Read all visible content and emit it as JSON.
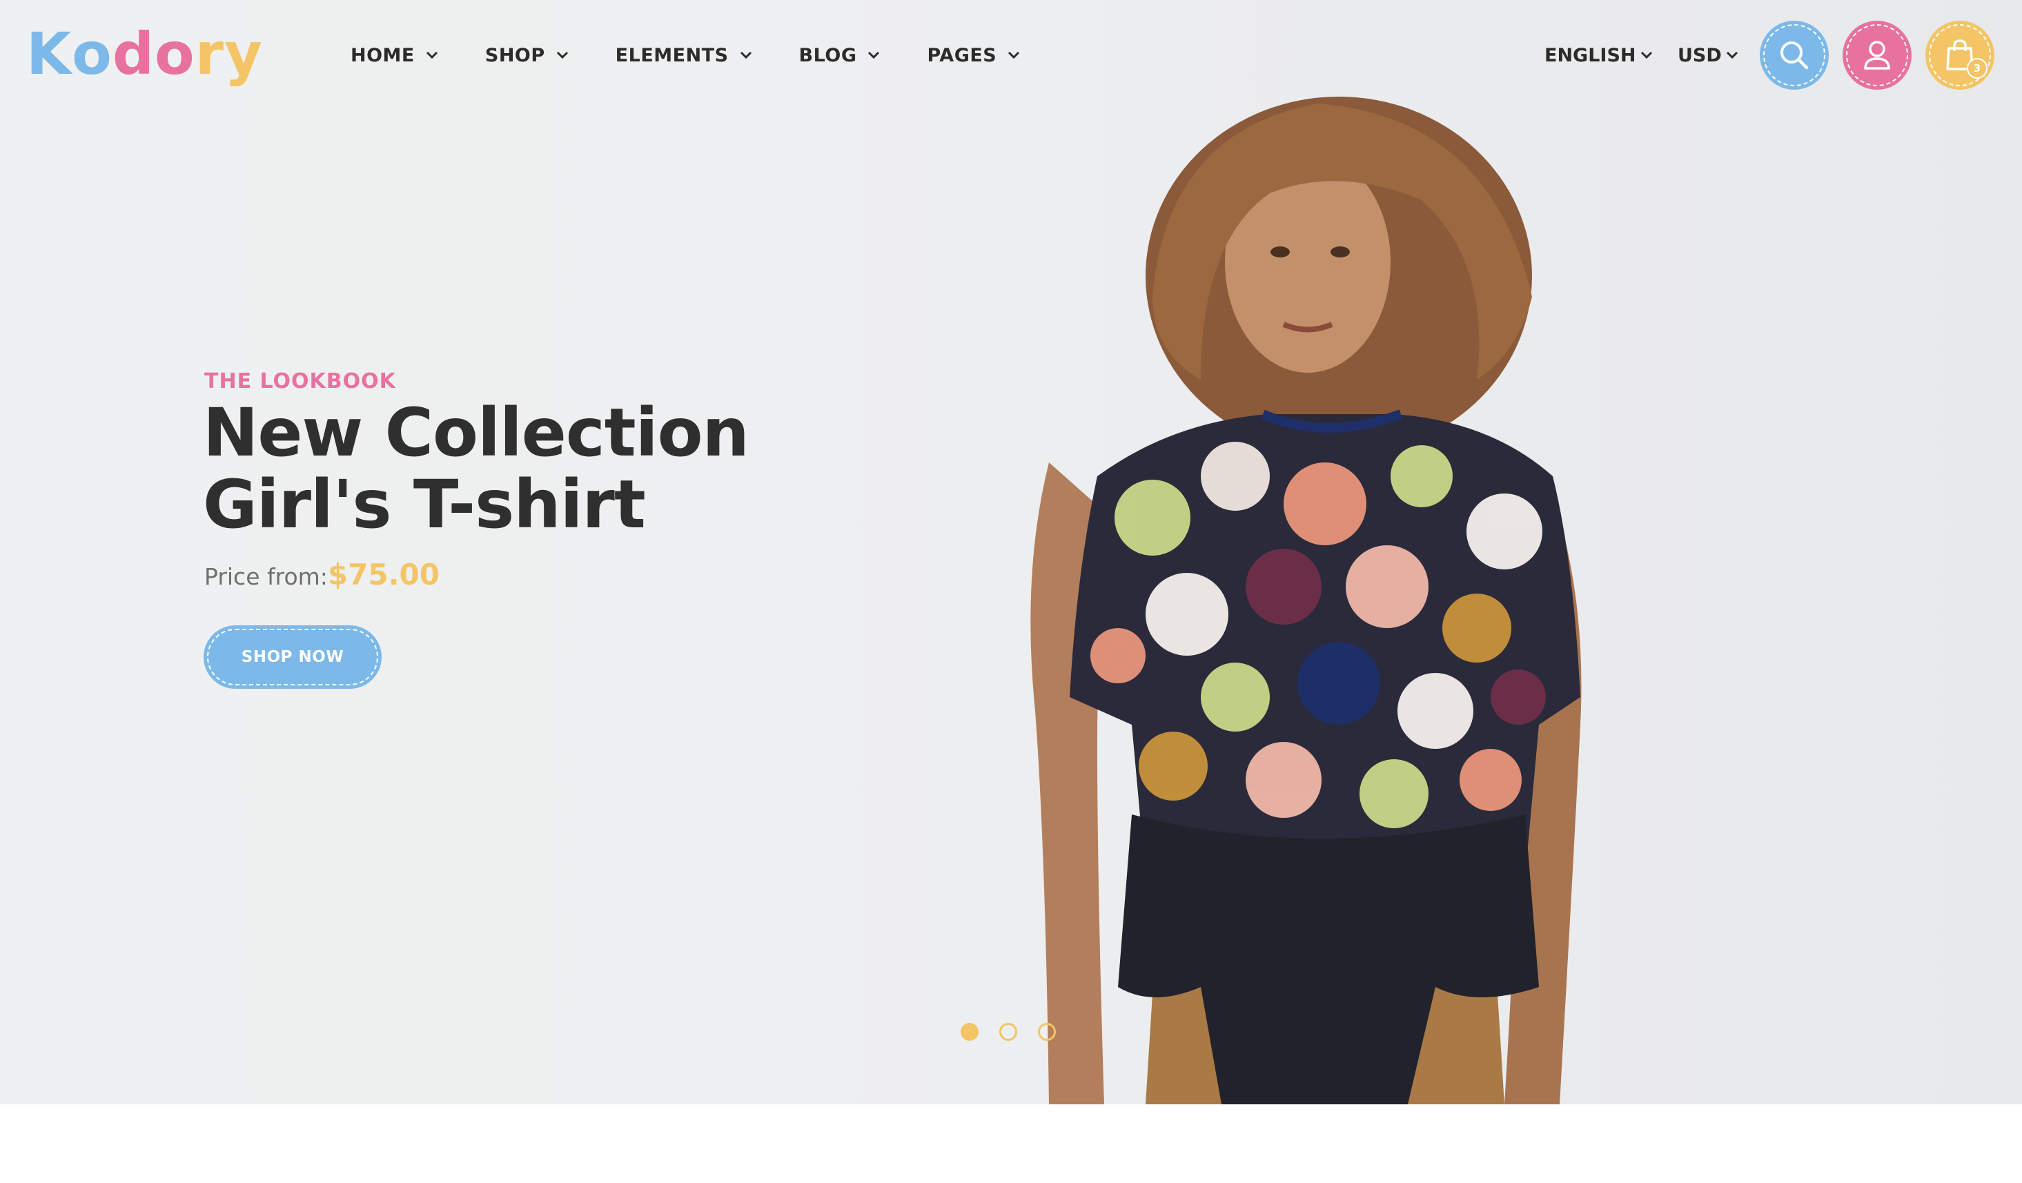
{
  "brand": {
    "letters": [
      {
        "char": "K",
        "color": "#7cb9e8"
      },
      {
        "char": "o",
        "color": "#7cb9e8"
      },
      {
        "char": "d",
        "color": "#e8729f"
      },
      {
        "char": "o",
        "color": "#e8729f"
      },
      {
        "char": "r",
        "color": "#f3c566"
      },
      {
        "char": "y",
        "color": "#f3c566"
      }
    ]
  },
  "nav": {
    "items": [
      {
        "label": "HOME"
      },
      {
        "label": "SHOP"
      },
      {
        "label": "ELEMENTS"
      },
      {
        "label": "BLOG"
      },
      {
        "label": "PAGES"
      }
    ]
  },
  "header_tools": {
    "language": "ENGLISH",
    "currency": "USD",
    "cart_count": "3",
    "icons": [
      "search-icon",
      "user-icon",
      "shopping-bag-icon"
    ],
    "colors": {
      "search": "#7cb9e8",
      "account": "#e8729f",
      "cart": "#f3c566"
    }
  },
  "hero": {
    "eyebrow": "THE LOOKBOOK",
    "title_line1": "New Collection",
    "title_line2": "Girl's T-shirt",
    "price_label": "Price from:",
    "price_value": "$75.00",
    "cta_label": "SHOP NOW"
  },
  "slider": {
    "slide_count": 3,
    "active_slide": 1,
    "dot_color": "#f3c566"
  },
  "colors": {
    "accent_blue": "#7cb9e8",
    "accent_pink": "#e8729f",
    "accent_yellow": "#f3c566",
    "text_dark": "#2f2f2f"
  }
}
